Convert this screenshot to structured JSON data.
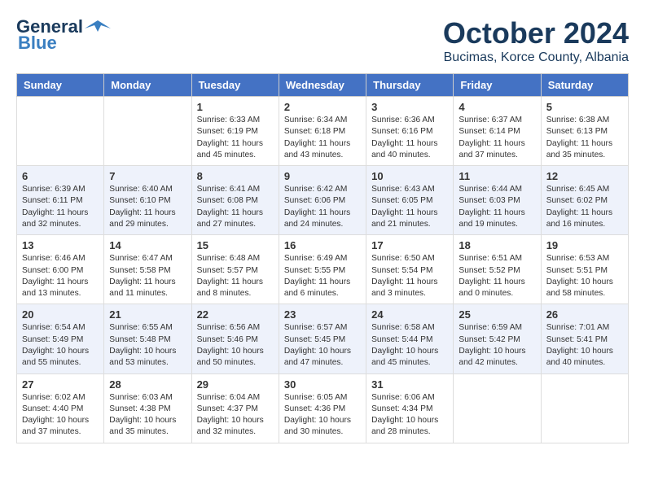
{
  "header": {
    "logo_general": "General",
    "logo_blue": "Blue",
    "month": "October 2024",
    "location": "Bucimas, Korce County, Albania"
  },
  "weekdays": [
    "Sunday",
    "Monday",
    "Tuesday",
    "Wednesday",
    "Thursday",
    "Friday",
    "Saturday"
  ],
  "rows": [
    [
      {
        "day": "",
        "sunrise": "",
        "sunset": "",
        "daylight": ""
      },
      {
        "day": "",
        "sunrise": "",
        "sunset": "",
        "daylight": ""
      },
      {
        "day": "1",
        "sunrise": "Sunrise: 6:33 AM",
        "sunset": "Sunset: 6:19 PM",
        "daylight": "Daylight: 11 hours and 45 minutes."
      },
      {
        "day": "2",
        "sunrise": "Sunrise: 6:34 AM",
        "sunset": "Sunset: 6:18 PM",
        "daylight": "Daylight: 11 hours and 43 minutes."
      },
      {
        "day": "3",
        "sunrise": "Sunrise: 6:36 AM",
        "sunset": "Sunset: 6:16 PM",
        "daylight": "Daylight: 11 hours and 40 minutes."
      },
      {
        "day": "4",
        "sunrise": "Sunrise: 6:37 AM",
        "sunset": "Sunset: 6:14 PM",
        "daylight": "Daylight: 11 hours and 37 minutes."
      },
      {
        "day": "5",
        "sunrise": "Sunrise: 6:38 AM",
        "sunset": "Sunset: 6:13 PM",
        "daylight": "Daylight: 11 hours and 35 minutes."
      }
    ],
    [
      {
        "day": "6",
        "sunrise": "Sunrise: 6:39 AM",
        "sunset": "Sunset: 6:11 PM",
        "daylight": "Daylight: 11 hours and 32 minutes."
      },
      {
        "day": "7",
        "sunrise": "Sunrise: 6:40 AM",
        "sunset": "Sunset: 6:10 PM",
        "daylight": "Daylight: 11 hours and 29 minutes."
      },
      {
        "day": "8",
        "sunrise": "Sunrise: 6:41 AM",
        "sunset": "Sunset: 6:08 PM",
        "daylight": "Daylight: 11 hours and 27 minutes."
      },
      {
        "day": "9",
        "sunrise": "Sunrise: 6:42 AM",
        "sunset": "Sunset: 6:06 PM",
        "daylight": "Daylight: 11 hours and 24 minutes."
      },
      {
        "day": "10",
        "sunrise": "Sunrise: 6:43 AM",
        "sunset": "Sunset: 6:05 PM",
        "daylight": "Daylight: 11 hours and 21 minutes."
      },
      {
        "day": "11",
        "sunrise": "Sunrise: 6:44 AM",
        "sunset": "Sunset: 6:03 PM",
        "daylight": "Daylight: 11 hours and 19 minutes."
      },
      {
        "day": "12",
        "sunrise": "Sunrise: 6:45 AM",
        "sunset": "Sunset: 6:02 PM",
        "daylight": "Daylight: 11 hours and 16 minutes."
      }
    ],
    [
      {
        "day": "13",
        "sunrise": "Sunrise: 6:46 AM",
        "sunset": "Sunset: 6:00 PM",
        "daylight": "Daylight: 11 hours and 13 minutes."
      },
      {
        "day": "14",
        "sunrise": "Sunrise: 6:47 AM",
        "sunset": "Sunset: 5:58 PM",
        "daylight": "Daylight: 11 hours and 11 minutes."
      },
      {
        "day": "15",
        "sunrise": "Sunrise: 6:48 AM",
        "sunset": "Sunset: 5:57 PM",
        "daylight": "Daylight: 11 hours and 8 minutes."
      },
      {
        "day": "16",
        "sunrise": "Sunrise: 6:49 AM",
        "sunset": "Sunset: 5:55 PM",
        "daylight": "Daylight: 11 hours and 6 minutes."
      },
      {
        "day": "17",
        "sunrise": "Sunrise: 6:50 AM",
        "sunset": "Sunset: 5:54 PM",
        "daylight": "Daylight: 11 hours and 3 minutes."
      },
      {
        "day": "18",
        "sunrise": "Sunrise: 6:51 AM",
        "sunset": "Sunset: 5:52 PM",
        "daylight": "Daylight: 11 hours and 0 minutes."
      },
      {
        "day": "19",
        "sunrise": "Sunrise: 6:53 AM",
        "sunset": "Sunset: 5:51 PM",
        "daylight": "Daylight: 10 hours and 58 minutes."
      }
    ],
    [
      {
        "day": "20",
        "sunrise": "Sunrise: 6:54 AM",
        "sunset": "Sunset: 5:49 PM",
        "daylight": "Daylight: 10 hours and 55 minutes."
      },
      {
        "day": "21",
        "sunrise": "Sunrise: 6:55 AM",
        "sunset": "Sunset: 5:48 PM",
        "daylight": "Daylight: 10 hours and 53 minutes."
      },
      {
        "day": "22",
        "sunrise": "Sunrise: 6:56 AM",
        "sunset": "Sunset: 5:46 PM",
        "daylight": "Daylight: 10 hours and 50 minutes."
      },
      {
        "day": "23",
        "sunrise": "Sunrise: 6:57 AM",
        "sunset": "Sunset: 5:45 PM",
        "daylight": "Daylight: 10 hours and 47 minutes."
      },
      {
        "day": "24",
        "sunrise": "Sunrise: 6:58 AM",
        "sunset": "Sunset: 5:44 PM",
        "daylight": "Daylight: 10 hours and 45 minutes."
      },
      {
        "day": "25",
        "sunrise": "Sunrise: 6:59 AM",
        "sunset": "Sunset: 5:42 PM",
        "daylight": "Daylight: 10 hours and 42 minutes."
      },
      {
        "day": "26",
        "sunrise": "Sunrise: 7:01 AM",
        "sunset": "Sunset: 5:41 PM",
        "daylight": "Daylight: 10 hours and 40 minutes."
      }
    ],
    [
      {
        "day": "27",
        "sunrise": "Sunrise: 6:02 AM",
        "sunset": "Sunset: 4:40 PM",
        "daylight": "Daylight: 10 hours and 37 minutes."
      },
      {
        "day": "28",
        "sunrise": "Sunrise: 6:03 AM",
        "sunset": "Sunset: 4:38 PM",
        "daylight": "Daylight: 10 hours and 35 minutes."
      },
      {
        "day": "29",
        "sunrise": "Sunrise: 6:04 AM",
        "sunset": "Sunset: 4:37 PM",
        "daylight": "Daylight: 10 hours and 32 minutes."
      },
      {
        "day": "30",
        "sunrise": "Sunrise: 6:05 AM",
        "sunset": "Sunset: 4:36 PM",
        "daylight": "Daylight: 10 hours and 30 minutes."
      },
      {
        "day": "31",
        "sunrise": "Sunrise: 6:06 AM",
        "sunset": "Sunset: 4:34 PM",
        "daylight": "Daylight: 10 hours and 28 minutes."
      },
      {
        "day": "",
        "sunrise": "",
        "sunset": "",
        "daylight": ""
      },
      {
        "day": "",
        "sunrise": "",
        "sunset": "",
        "daylight": ""
      }
    ]
  ]
}
